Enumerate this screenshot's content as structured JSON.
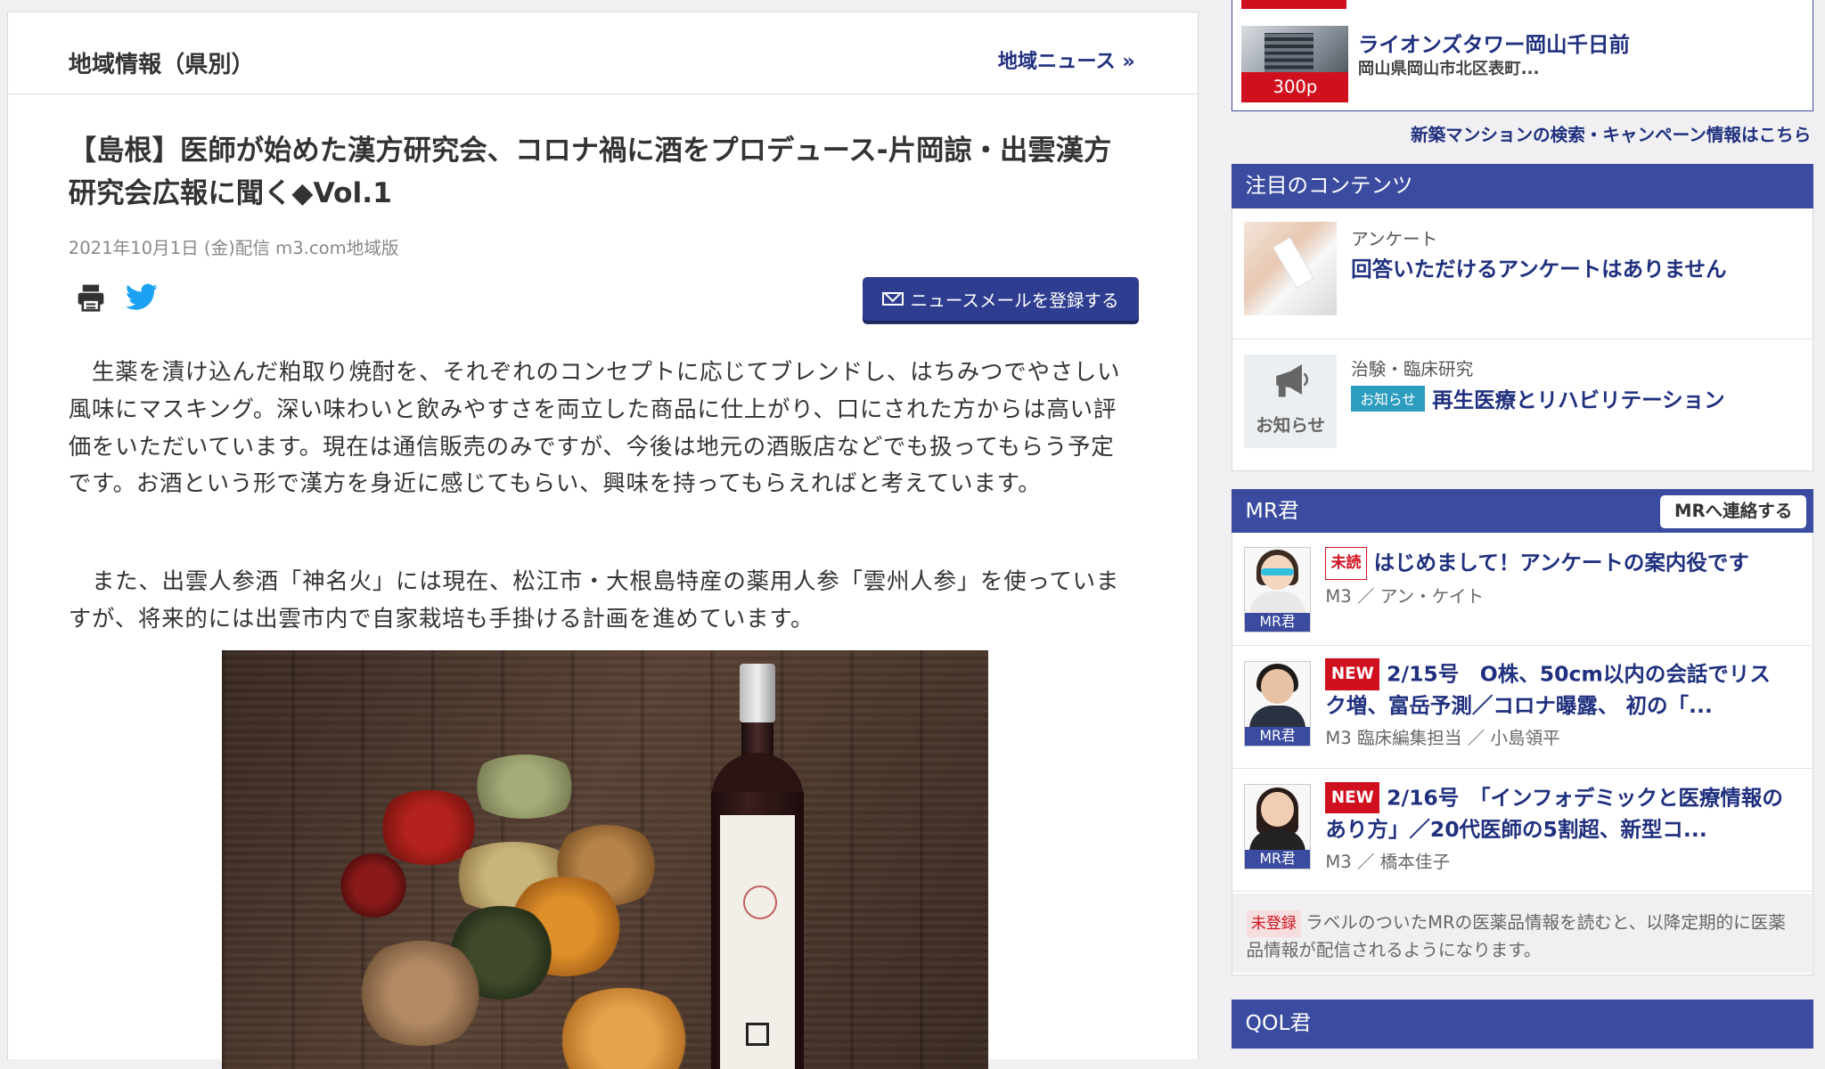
{
  "section": {
    "title": "地域情報（県別）",
    "link": "地域ニュース »"
  },
  "article": {
    "title": "【島根】医師が始めた漢方研究会、コロナ禍に酒をプロデュース-片岡諒・出雲漢方研究会広報に聞く◆Vol.1",
    "meta": "2021年10月1日 (金)配信  m3.com地域版",
    "newsmail_label": "ニュースメールを登録する",
    "paragraphs": [
      "　生薬を漬け込んだ粕取り焼酎を、それぞれのコンセプトに応じてブレンドし、はちみつでやさしい風味にマスキング。深い味わいと飲みやすさを両立した商品に仕上がり、口にされた方からは高い評価をいただいています。現在は通信販売のみですが、今後は地元の酒販店などでも扱ってもらう予定です。お酒という形で漢方を身近に感じてもらい、興味を持ってもらえればと考えています。",
      "　また、出雲人参酒「神名火」には現在、松江市・大根島特産の薬用人参「雲州人参」を使っていますが、将来的には出雲市内で自家栽培も手掛ける計画を進めています。"
    ],
    "icons": [
      "printer-icon",
      "twitter-icon",
      "envelope-icon"
    ]
  },
  "sidebar": {
    "mansion": {
      "name": "ライオンズタワー岡山千日前",
      "address": "岡山県岡山市北区表町...",
      "price": "300p",
      "link": "新築マンションの検索・キャンペーン情報はこちら"
    },
    "featured": {
      "heading": "注目のコンテンツ",
      "items": [
        {
          "category": "アンケート",
          "title": "回答いただけるアンケートはありません"
        },
        {
          "category": "治験・臨床研究",
          "badge": "お知らせ",
          "title": "再生医療とリハビリテーション",
          "thumb_label": "お知らせ"
        }
      ]
    },
    "mr": {
      "heading": "MR君",
      "contact_button": "MRへ連絡する",
      "items": [
        {
          "badge": "未読",
          "title": "はじめまして！アンケートの案内役です",
          "sub": "M3 ／ アン・ケイト",
          "tag": "MR君"
        },
        {
          "badge": "NEW",
          "title": "2/15号　O株、50cm以内の会話でリスク増、富岳予測／コロナ曝露、 初の「...",
          "sub": "M3 臨床編集担当 ／ 小島領平",
          "tag": "MR君"
        },
        {
          "badge": "NEW",
          "title": "2/16号　「インフォデミックと医療情報のあり方」／20代医師の5割超、新型コ...",
          "sub": "M3 ／ 橋本佳子",
          "tag": "MR君"
        }
      ],
      "note_badge": "未登録",
      "note": "ラベルのついたMRの医薬品情報を読むと、以降定期的に医薬品情報が配信されるようになります。"
    },
    "qol": {
      "heading": "QOL君"
    }
  },
  "colors": {
    "brand_navy": "#3a4ba0",
    "link_blue": "#20307e",
    "accent_red": "#d0101e",
    "twitter_blue": "#1da1f2"
  }
}
